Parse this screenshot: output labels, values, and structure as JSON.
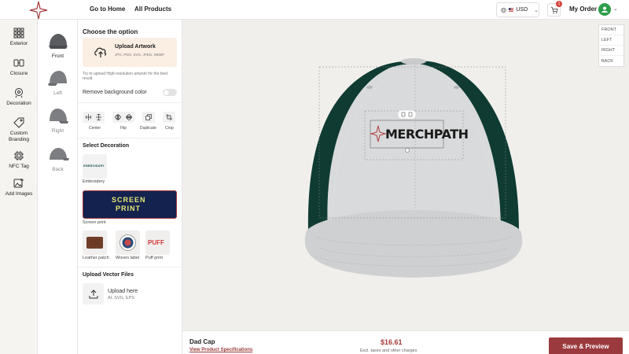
{
  "header": {
    "nav": [
      "Go to Home",
      "All Products"
    ],
    "currency": "USD",
    "cart_count": "1",
    "my_order": "My Order"
  },
  "rail": {
    "items": [
      {
        "label": "Exterior",
        "icon": "grid-icon"
      },
      {
        "label": "Closure",
        "icon": "closure-icon"
      },
      {
        "label": "Decoration",
        "icon": "decoration-icon"
      },
      {
        "label": "Custom Branding",
        "icon": "tag-icon"
      },
      {
        "label": "NFC Tag",
        "icon": "chip-icon"
      },
      {
        "label": "Add Images",
        "icon": "image-add-icon"
      }
    ]
  },
  "views": {
    "items": [
      {
        "label": "Front"
      },
      {
        "label": "Left"
      },
      {
        "label": "Right"
      },
      {
        "label": "Back"
      }
    ]
  },
  "panel": {
    "title": "Choose the option",
    "upload": {
      "title": "Upload Artwork",
      "formats": "JPG, PNG, SVG, JPEG, WEBP"
    },
    "hint": "Try to upload High-resolution artwork for the best result.",
    "remove_bg": "Remove background color",
    "tools": {
      "center": "Center",
      "flip": "Flip",
      "duplicate": "Duplicate",
      "crop": "Crop"
    },
    "select_decoration": "Select Decoration",
    "decorations": {
      "embroidery": {
        "label": "Embroidery",
        "thumb_text": "EMBROIDARY"
      },
      "screen_print": {
        "label": "Screen print",
        "thumb_text_1": "SCREEN",
        "thumb_text_2": "PRINT"
      },
      "leather_patch": {
        "label": "Leather patch"
      },
      "woven_label": {
        "label": "Woven label"
      },
      "puff_print": {
        "label": "Puff print",
        "thumb_text": "PUFF"
      }
    },
    "upload_vector": {
      "title": "Upload Vector Files",
      "box_title": "Upload here",
      "box_sub": "AI, SVG, EPS"
    }
  },
  "canvas": {
    "side_tabs": [
      "FRONT",
      "LEFT",
      "RIGHT",
      "BACK"
    ],
    "logo_text": "MERCHPATH"
  },
  "footer": {
    "product_name": "Dad Cap",
    "specs_link": "View Product Specifications",
    "price": "$16.61",
    "price_note": "Excl. taxes and other charges",
    "save_button": "Save & Preview"
  },
  "colors": {
    "accent": "#9b3a3e",
    "cap_body": "#d9dadb",
    "cap_mesh": "#0f3b33",
    "upload_bg": "#fbeee3"
  }
}
